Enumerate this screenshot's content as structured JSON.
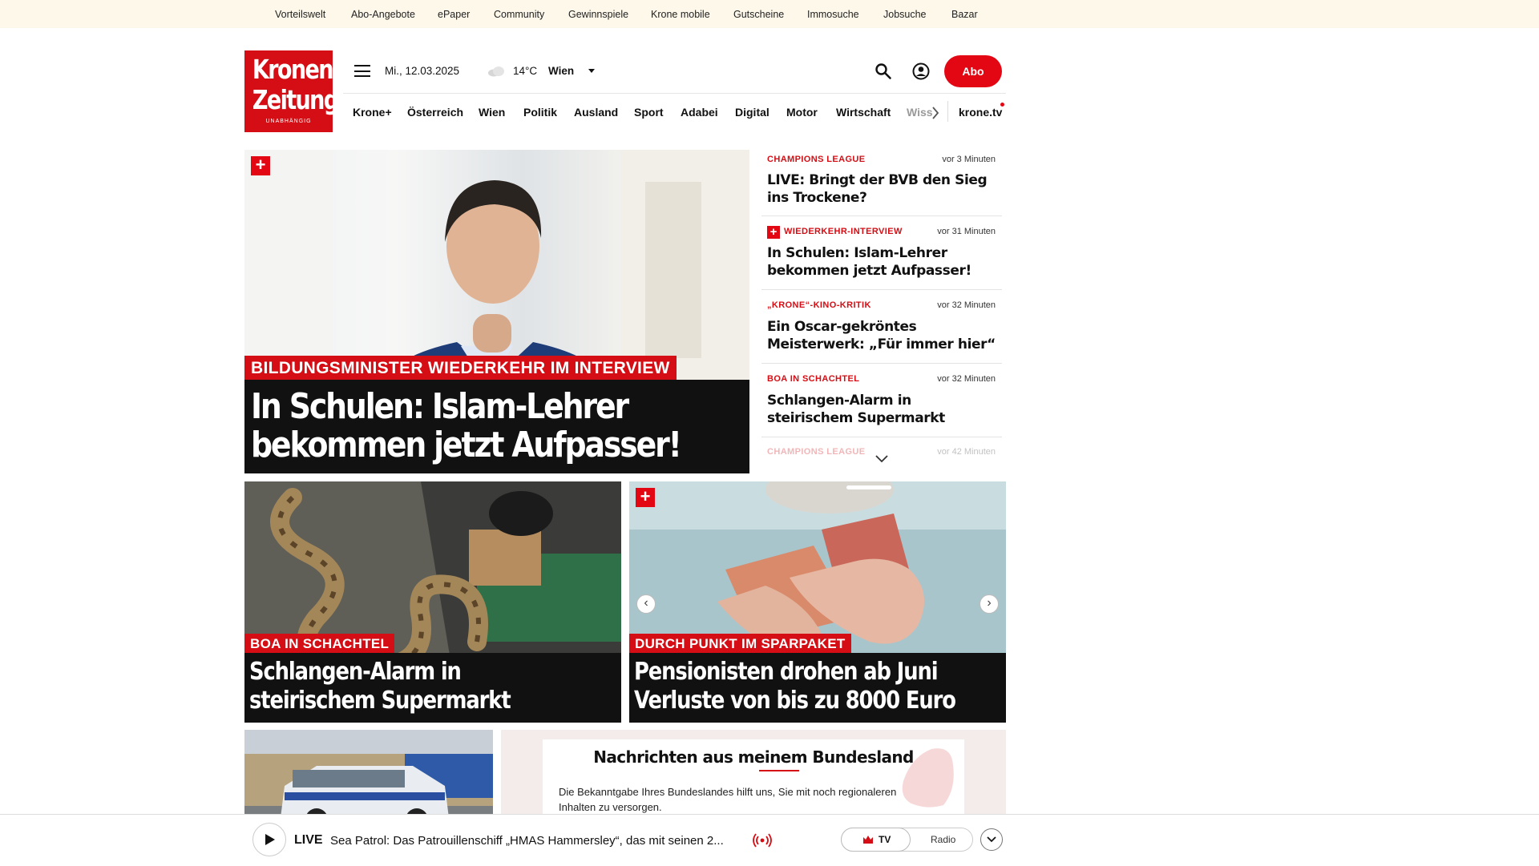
{
  "topbar": {
    "links": [
      "Vorteilswelt",
      "Abo-Angebote",
      "ePaper",
      "Community",
      "Gewinnspiele",
      "Krone mobile",
      "Gutscheine",
      "Immosuche",
      "Jobsuche",
      "Bazar"
    ]
  },
  "logo": {
    "line1": "Kronen",
    "line2": "Zeitung",
    "tagline": "UNABHÄNGIG"
  },
  "header": {
    "date": "Mi., 12.03.2025",
    "temperature": "14°C",
    "location": "Wien",
    "abo_label": "Abo"
  },
  "nav": {
    "items": [
      "Krone+",
      "Österreich",
      "Wien",
      "Politik",
      "Ausland",
      "Sport",
      "Adabei",
      "Digital",
      "Motor",
      "Wirtschaft",
      "Wiss"
    ],
    "tv": "krone.tv"
  },
  "hero": {
    "kicker": "BILDUNGSMINISTER WIEDERKEHR IM INTERVIEW",
    "headline_line1": "In Schulen: Islam-Lehrer",
    "headline_line2": "bekommen jetzt Aufpasser!",
    "badge": "+"
  },
  "news_list": [
    {
      "kicker": "CHAMPIONS LEAGUE",
      "time": "vor 3 Minuten",
      "title": "LIVE: Bringt der BVB den Sieg ins Trockene?"
    },
    {
      "kicker": "WIEDERKEHR-INTERVIEW",
      "time": "vor 31 Minuten",
      "title": "In Schulen: Islam-Lehrer bekommen jetzt Aufpasser!",
      "plus": "+"
    },
    {
      "kicker": "„KRONE“-KINO-KRITIK",
      "time": "vor 32 Minuten",
      "title": "Ein Oscar-gekröntes Meisterwerk: „Für immer hier“"
    },
    {
      "kicker": "BOA IN SCHACHTEL",
      "time": "vor 32 Minuten",
      "title": "Schlangen-Alarm in steirischem Supermarkt"
    },
    {
      "kicker": "CHAMPIONS LEAGUE",
      "time": "vor 42 Minuten",
      "title": ""
    }
  ],
  "tile_left": {
    "kicker": "BOA IN SCHACHTEL",
    "headline_line1": "Schlangen-Alarm in",
    "headline_line2": "steirischem Supermarkt"
  },
  "tile_right": {
    "kicker": "DURCH PUNKT IM SPARPAKET",
    "headline_line1": "Pensionisten drohen ab Juni",
    "headline_line2": "Verluste von bis zu 8000 Euro",
    "badge": "+"
  },
  "bundesland": {
    "title": "Nachrichten aus meinem Bundesland",
    "text": "Die Bekanntgabe Ihres Bundeslandes hilft uns, Sie mit noch regionaleren Inhalten zu versorgen."
  },
  "player": {
    "live_label": "LIVE",
    "title": "Sea Patrol: Das Patrouillenschiff „HMAS Hammersley“, das mit seinen 2...",
    "tv_label": "TV",
    "radio_label": "Radio"
  },
  "colors": {
    "brand_red": "#d40e14",
    "abo_red": "#e30613",
    "topbar_bg": "#fdf8ea"
  }
}
